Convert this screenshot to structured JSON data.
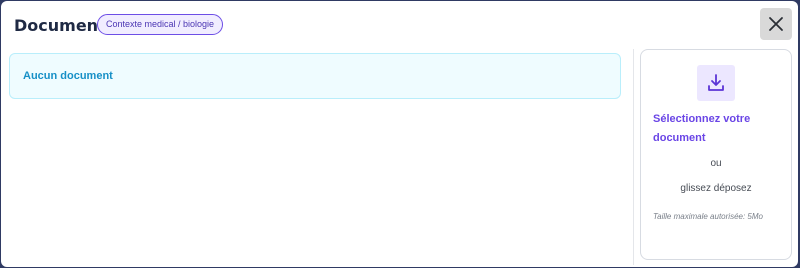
{
  "header": {
    "title": "Documents",
    "tag": "Contexte medical / biologie",
    "close_icon": "close-icon"
  },
  "documents": {
    "empty_message": "Aucun document"
  },
  "upload": {
    "icon": "download-icon",
    "select_label": "Sélectionnez votre document",
    "or_label": "ou",
    "drop_label": "glissez déposez",
    "max_size_label": "Taille maximale autorisée: 5Mo"
  },
  "colors": {
    "accent": "#6a45e6",
    "info": "#1790c7",
    "info_bg": "#effcff"
  }
}
